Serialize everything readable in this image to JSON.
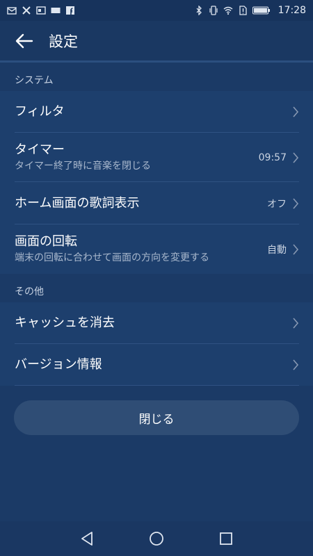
{
  "status_bar": {
    "time": "17:28",
    "left_icons": [
      "mail-icon",
      "tools-icon",
      "card-icon",
      "docs-icon",
      "facebook-icon"
    ],
    "right_icons": [
      "bluetooth-icon",
      "vibrate-icon",
      "wifi-icon",
      "sim-alert-icon",
      "battery-icon"
    ]
  },
  "header": {
    "title": "設定"
  },
  "sections": [
    {
      "header": "システム",
      "items": [
        {
          "title": "フィルタ",
          "subtitle": "",
          "value": ""
        },
        {
          "title": "タイマー",
          "subtitle": "タイマー終了時に音楽を閉じる",
          "value": "09:57"
        },
        {
          "title": "ホーム画面の歌詞表示",
          "subtitle": "",
          "value": "オフ"
        },
        {
          "title": "画面の回転",
          "subtitle": "端末の回転に合わせて画面の方向を変更する",
          "value": "自動"
        }
      ]
    },
    {
      "header": "その他",
      "items": [
        {
          "title": "キャッシュを消去",
          "subtitle": "",
          "value": ""
        },
        {
          "title": "バージョン情報",
          "subtitle": "",
          "value": ""
        }
      ]
    }
  ],
  "close_button": {
    "label": "閉じる"
  },
  "colors": {
    "background": "#1b3a66",
    "row_background": "#1d3f6d",
    "button_background": "#2f4d75"
  }
}
